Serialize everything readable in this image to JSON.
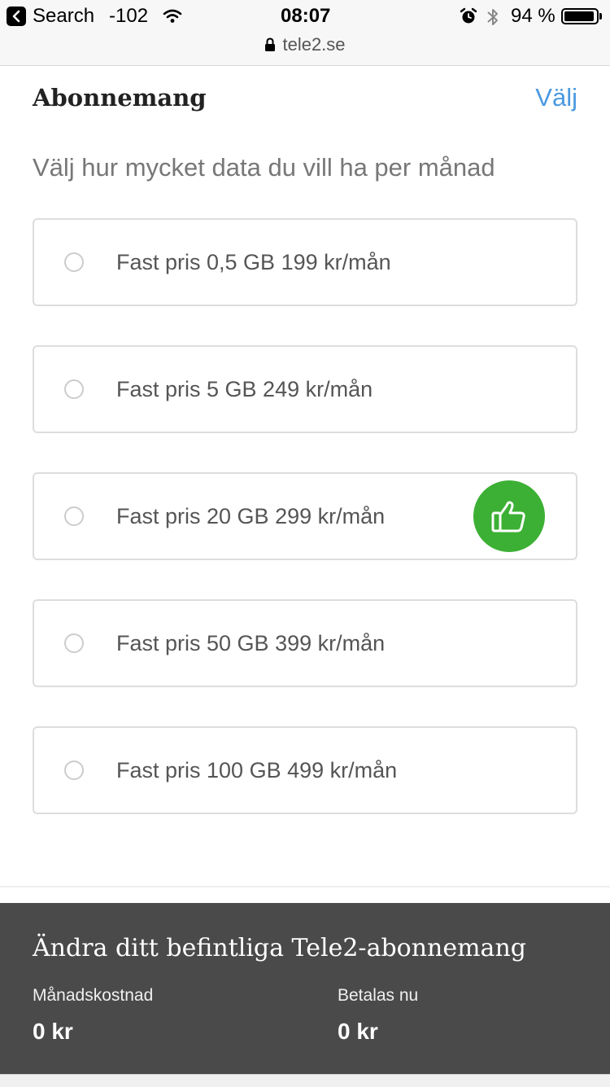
{
  "status_bar": {
    "back_app": "Search",
    "signal": "-102",
    "time": "08:07",
    "battery_percent": "94 %",
    "battery_level": 0.94,
    "icons": [
      "back-arrow-icon",
      "wifi-icon",
      "alarm-icon",
      "bluetooth-icon",
      "battery-icon",
      "lock-icon"
    ]
  },
  "browser": {
    "url": "tele2.se"
  },
  "header": {
    "title": "Abonnemang",
    "action": "Välj"
  },
  "subtitle": "Välj hur mycket data du vill ha per månad",
  "options": [
    {
      "label": "Fast pris 0,5 GB 199 kr/mån",
      "recommended": false
    },
    {
      "label": "Fast pris 5 GB 249 kr/mån",
      "recommended": false
    },
    {
      "label": "Fast pris 20 GB 299 kr/mån",
      "recommended": true,
      "badge_icon": "thumbs-up-icon",
      "badge_color": "#3cb034"
    },
    {
      "label": "Fast pris 50 GB 399 kr/mån",
      "recommended": false
    },
    {
      "label": "Fast pris 100 GB 499 kr/mån",
      "recommended": false
    }
  ],
  "footer": {
    "title": "Ändra ditt befintliga Tele2-abonnemang",
    "monthly_label": "Månadskostnad",
    "monthly_value": "0 kr",
    "pay_now_label": "Betalas nu",
    "pay_now_value": "0 kr"
  },
  "colors": {
    "accent_link": "#4a9ae0",
    "footer_bg": "#4a4a4a",
    "recommended_badge": "#3cb034"
  }
}
